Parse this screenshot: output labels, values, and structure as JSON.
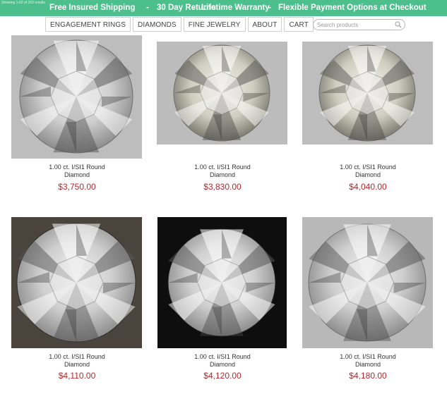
{
  "topbar": {
    "tiny_text": "Showing 1-60 of 263 results",
    "promos": [
      "Free Insured Shipping",
      "30 Day Returns",
      "Lifetime Warranty",
      "Flexible Payment Options at Checkout"
    ],
    "separator": "-",
    "background": "#4cbf8c"
  },
  "nav": {
    "items": [
      "ENGAGEMENT RINGS",
      "DIAMONDS",
      "FINE JEWELRY",
      "ABOUT",
      "CART"
    ]
  },
  "search": {
    "placeholder": "Search products",
    "icon": "magnifier-icon"
  },
  "products": [
    {
      "title_line1": "1.00 ct. I/SI1 Round",
      "title_line2": "Diamond",
      "price": "$3,750.00",
      "bg": "#bdbdbd"
    },
    {
      "title_line1": "1.00 ct. I/SI1 Round",
      "title_line2": "Diamond",
      "price": "$3,830.00",
      "bg": "#bcbcbc"
    },
    {
      "title_line1": "1.00 ct. I/SI1 Round",
      "title_line2": "Diamond",
      "price": "$4,040.00",
      "bg": "#bdbdbd"
    },
    {
      "title_line1": "1.00 ct. I/SI1 Round",
      "title_line2": "Diamond",
      "price": "$4,110.00",
      "bg": "#4a443d"
    },
    {
      "title_line1": "1.00 ct. I/SI1 Round",
      "title_line2": "Diamond",
      "price": "$4,120.00",
      "bg": "#0e0e0e"
    },
    {
      "title_line1": "1.00 ct. I/SI1 Round",
      "title_line2": "Diamond",
      "price": "$4,180.00",
      "bg": "#b8b8b8"
    }
  ],
  "colors": {
    "price": "#b3272d",
    "accent": "#4cbf8c"
  }
}
